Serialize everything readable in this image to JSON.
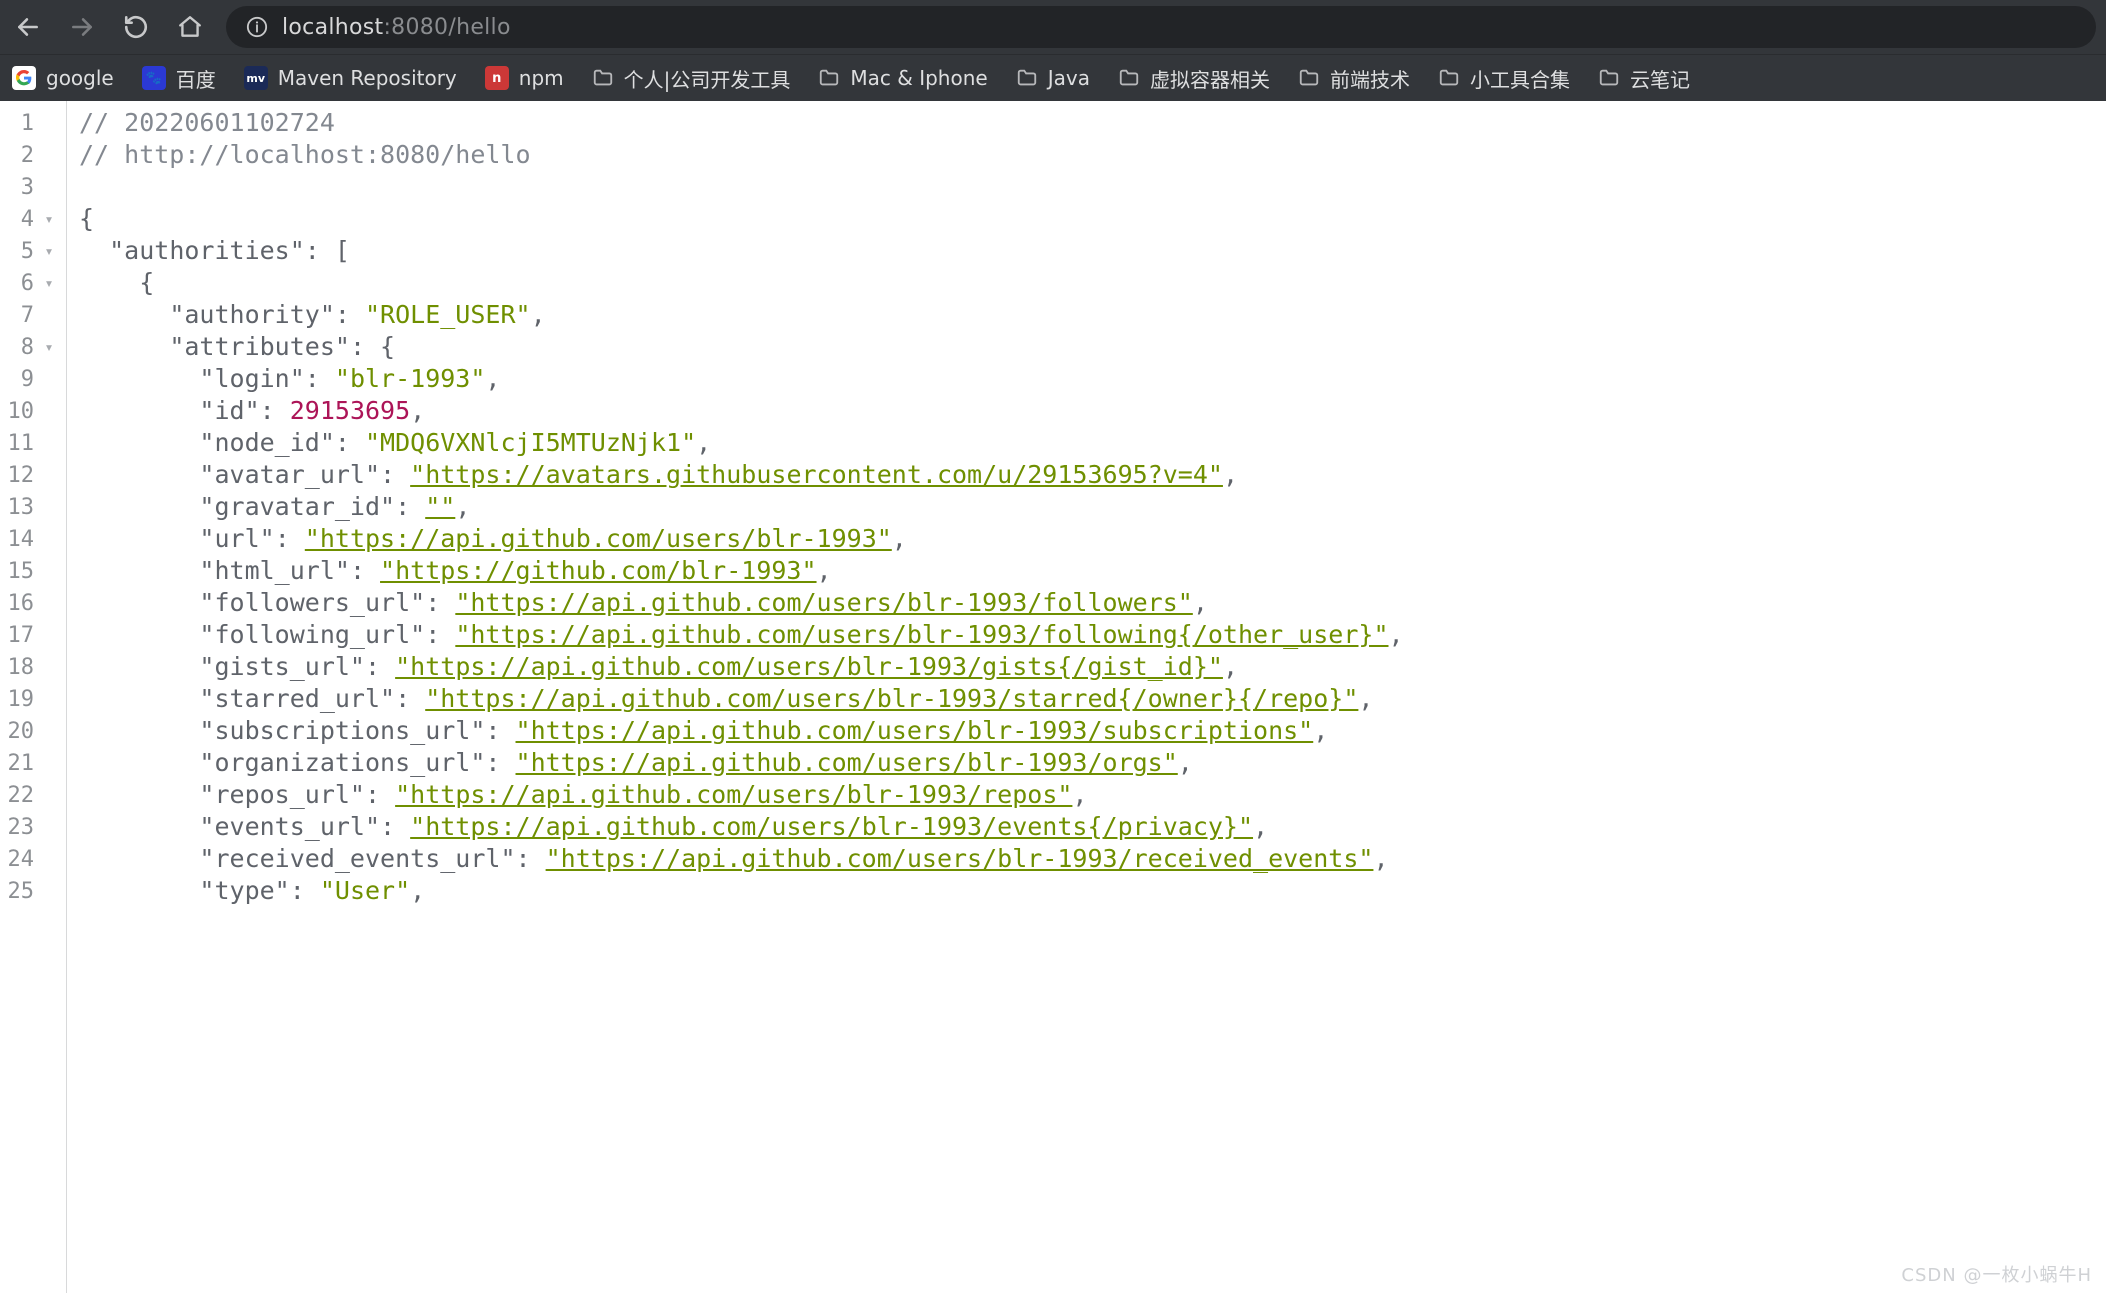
{
  "toolbar": {
    "url_host": "localhost",
    "url_port": ":8080",
    "url_path": "/hello"
  },
  "bookmarks": [
    {
      "label": "google",
      "iconType": "g"
    },
    {
      "label": "百度",
      "iconType": "b"
    },
    {
      "label": "Maven Repository",
      "iconType": "m"
    },
    {
      "label": "npm",
      "iconType": "n"
    },
    {
      "label": "个人|公司开发工具",
      "iconType": "folder"
    },
    {
      "label": "Mac & Iphone",
      "iconType": "folder"
    },
    {
      "label": "Java",
      "iconType": "folder"
    },
    {
      "label": "虚拟容器相关",
      "iconType": "folder"
    },
    {
      "label": "前端技术",
      "iconType": "folder"
    },
    {
      "label": "小工具合集",
      "iconType": "folder"
    },
    {
      "label": "云笔记",
      "iconType": "folder"
    }
  ],
  "code": {
    "comment1": "// 20220601102724",
    "comment2": "// http://localhost:8080/hello",
    "brace_open": "{",
    "authorities_key": "\"authorities\"",
    "colon_sp": ": ",
    "bracket_open": "[",
    "inner_brace_open": "{",
    "authority_key": "\"authority\"",
    "authority_val": "\"ROLE_USER\"",
    "comma": ",",
    "attributes_key": "\"attributes\"",
    "attr_brace": "{",
    "login_key": "\"login\"",
    "login_val": "\"blr-1993\"",
    "id_key": "\"id\"",
    "id_val": "29153695",
    "node_id_key": "\"node_id\"",
    "node_id_val": "\"MDQ6VXNlcjI5MTUzNjk1\"",
    "avatar_url_key": "\"avatar_url\"",
    "avatar_url_val": "\"https://avatars.githubusercontent.com/u/29153695?v=4\"",
    "gravatar_id_key": "\"gravatar_id\"",
    "gravatar_id_val": "\"\"",
    "url_key": "\"url\"",
    "url_val": "\"https://api.github.com/users/blr-1993\"",
    "html_url_key": "\"html_url\"",
    "html_url_val": "\"https://github.com/blr-1993\"",
    "followers_url_key": "\"followers_url\"",
    "followers_url_val": "\"https://api.github.com/users/blr-1993/followers\"",
    "following_url_key": "\"following_url\"",
    "following_url_val": "\"https://api.github.com/users/blr-1993/following{/other_user}\"",
    "gists_url_key": "\"gists_url\"",
    "gists_url_val": "\"https://api.github.com/users/blr-1993/gists{/gist_id}\"",
    "starred_url_key": "\"starred_url\"",
    "starred_url_val": "\"https://api.github.com/users/blr-1993/starred{/owner}{/repo}\"",
    "subscriptions_url_key": "\"subscriptions_url\"",
    "subscriptions_url_val": "\"https://api.github.com/users/blr-1993/subscriptions\"",
    "organizations_url_key": "\"organizations_url\"",
    "organizations_url_val": "\"https://api.github.com/users/blr-1993/orgs\"",
    "repos_url_key": "\"repos_url\"",
    "repos_url_val": "\"https://api.github.com/users/blr-1993/repos\"",
    "events_url_key": "\"events_url\"",
    "events_url_val": "\"https://api.github.com/users/blr-1993/events{/privacy}\"",
    "received_events_url_key": "\"received_events_url\"",
    "received_events_url_val": "\"https://api.github.com/users/blr-1993/received_events\"",
    "type_key": "\"type\"",
    "type_val": "\"User\""
  },
  "gutter": {
    "lines": [
      "1",
      "2",
      "3",
      "4",
      "5",
      "6",
      "7",
      "8",
      "9",
      "10",
      "11",
      "12",
      "13",
      "14",
      "15",
      "16",
      "17",
      "18",
      "19",
      "20",
      "21",
      "22",
      "23",
      "24",
      "25"
    ],
    "folds": {
      "4": "▾",
      "5": "▾",
      "6": "▾",
      "8": "▾"
    }
  },
  "watermark": "CSDN @一枚小蜗牛H"
}
